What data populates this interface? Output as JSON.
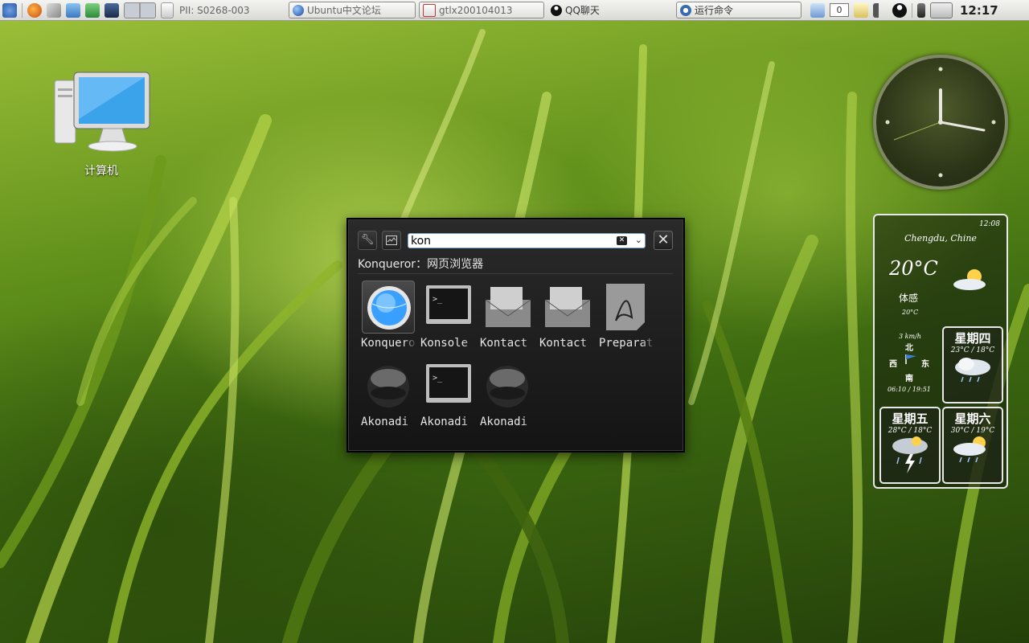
{
  "panel": {
    "tasks": [
      {
        "label": "PII: S0268-003",
        "icon": "document-icon"
      },
      {
        "label": "Ubuntu中文论坛",
        "icon": "globe-icon"
      },
      {
        "label": "gtlx200104013",
        "icon": "pdf-icon"
      },
      {
        "label": "QQ聊天",
        "icon": "qq-penguin-icon"
      }
    ],
    "run_command": "运行命令",
    "counter": "0",
    "clock": "12:17"
  },
  "desktop": {
    "icon_label": "计算机"
  },
  "weather": {
    "time": "12:08",
    "city": "Chengdu, Chine",
    "temperature": "20°C",
    "feels_label": "体感",
    "feels_value": "20°C",
    "wind_speed": "3 km/h",
    "dir_n": "北",
    "dir_w": "西",
    "dir_e": "东",
    "dir_s": "南",
    "sun_times": "06:10 / 19:51",
    "forecast": [
      {
        "day": "星期四",
        "range": "23°C / 18°C",
        "icon": "cloud-rain-icon"
      },
      {
        "day": "星期五",
        "range": "28°C / 18°C",
        "icon": "thunderstorm-icon"
      },
      {
        "day": "星期六",
        "range": "30°C / 19°C",
        "icon": "sun-rain-icon"
      }
    ]
  },
  "krunner": {
    "query": "kon",
    "description": "Konqueror：网页浏览器",
    "results": [
      {
        "label": "Konqueror",
        "icon": "konqueror-globe-icon"
      },
      {
        "label": "Konsole",
        "icon": "terminal-icon"
      },
      {
        "label": "Kontact",
        "icon": "kontact-icon"
      },
      {
        "label": "Kontact",
        "icon": "kontact-icon"
      },
      {
        "label": "Preparation",
        "icon": "pdf-document-icon"
      },
      {
        "label": "Akonadi",
        "icon": "akonadi-icon"
      },
      {
        "label": "Akonadi",
        "icon": "terminal-icon"
      },
      {
        "label": "Akonadi",
        "icon": "akonadi-icon"
      }
    ]
  }
}
